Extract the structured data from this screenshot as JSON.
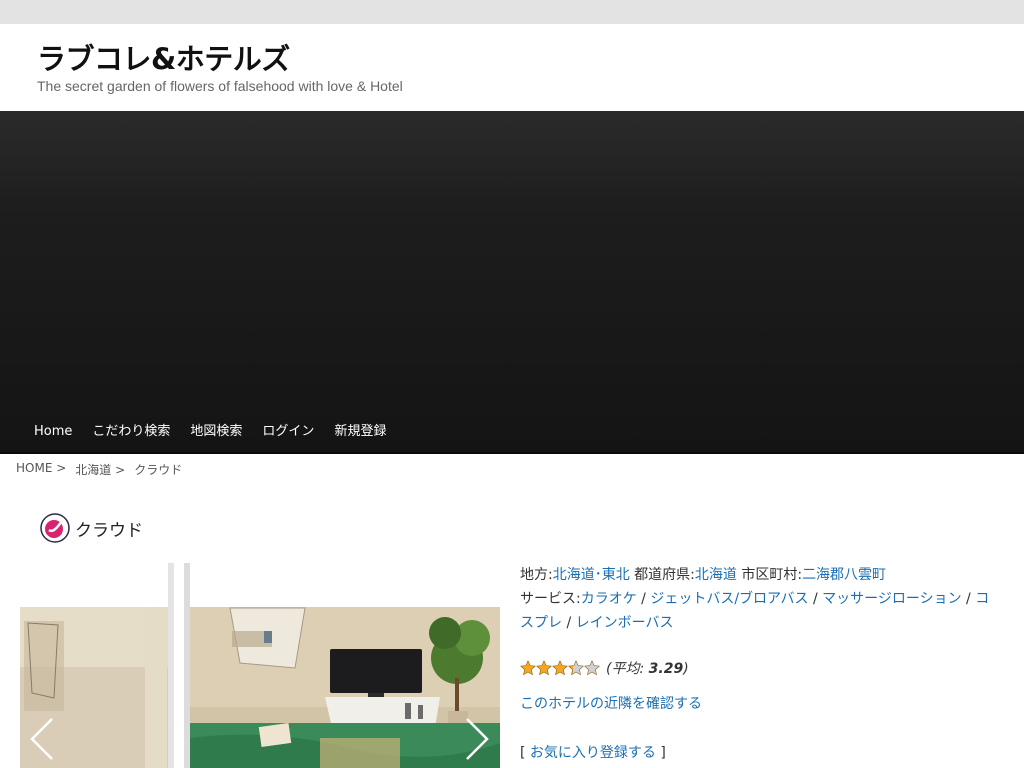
{
  "site": {
    "title": "ラブコレ&ホテルズ",
    "description": "The secret garden of flowers of falsehood with love & Hotel"
  },
  "nav": {
    "items": [
      {
        "label": "Home"
      },
      {
        "label": "こだわり検索"
      },
      {
        "label": "地図検索"
      },
      {
        "label": "ログイン"
      },
      {
        "label": "新規登録"
      }
    ]
  },
  "breadcrumb": {
    "home": "HOME",
    "region": "北海道",
    "current": "クラウド",
    "separator": ">"
  },
  "page": {
    "title": "クラウド"
  },
  "info": {
    "region_label": "地方:",
    "region_value": "北海道･東北",
    "pref_label": "都道府県:",
    "pref_value": "北海道",
    "city_label": "市区町村:",
    "city_value": "二海郡八雲町",
    "service_label": "サービス:",
    "services": [
      "カラオケ",
      "ジェットバス/ブロアバス",
      "マッサージローション",
      "コスプレ",
      "レインボーバス"
    ],
    "service_sep": " / "
  },
  "rating": {
    "stars_filled": 3.29,
    "stars_total": 5,
    "avg_open": "(",
    "avg_label": "平均: ",
    "avg_value": "3.29",
    "avg_close": ")"
  },
  "links": {
    "nearby": "このホテルの近隣を確認する",
    "fav_open": "[ ",
    "fav": "お気に入り登録する",
    "fav_close": " ]"
  },
  "colors": {
    "link": "#1a6fb3",
    "star": "#f5a623",
    "hero": "#1a1a1a"
  }
}
